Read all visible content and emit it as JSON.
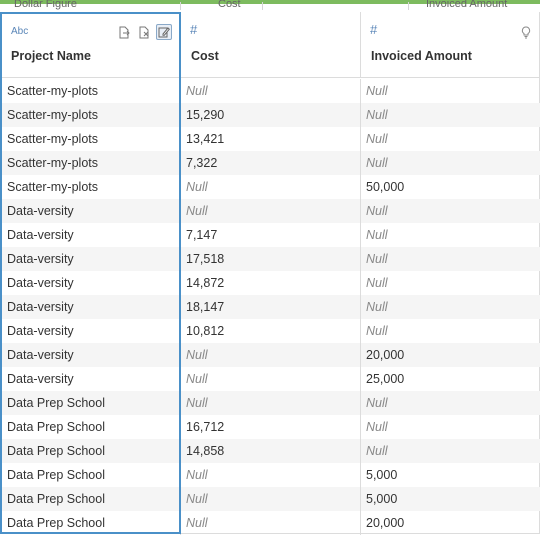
{
  "top_ghost": {
    "col1": "Dollar Figure",
    "col2": "Cost",
    "col3": "Invoiced Amount"
  },
  "columns": [
    {
      "type": "Abc",
      "name": "Project Name"
    },
    {
      "type": "#",
      "name": "Cost"
    },
    {
      "type": "#",
      "name": "Invoiced Amount"
    }
  ],
  "rows": [
    [
      "Scatter-my-plots",
      "Null",
      "Null"
    ],
    [
      "Scatter-my-plots",
      "15,290",
      "Null"
    ],
    [
      "Scatter-my-plots",
      "13,421",
      "Null"
    ],
    [
      "Scatter-my-plots",
      "7,322",
      "Null"
    ],
    [
      "Scatter-my-plots",
      "Null",
      "50,000"
    ],
    [
      "Data-versity",
      "Null",
      "Null"
    ],
    [
      "Data-versity",
      "7,147",
      "Null"
    ],
    [
      "Data-versity",
      "17,518",
      "Null"
    ],
    [
      "Data-versity",
      "14,872",
      "Null"
    ],
    [
      "Data-versity",
      "18,147",
      "Null"
    ],
    [
      "Data-versity",
      "10,812",
      "Null"
    ],
    [
      "Data-versity",
      "Null",
      "20,000"
    ],
    [
      "Data-versity",
      "Null",
      "25,000"
    ],
    [
      "Data Prep School",
      "Null",
      "Null"
    ],
    [
      "Data Prep School",
      "16,712",
      "Null"
    ],
    [
      "Data Prep School",
      "14,858",
      "Null"
    ],
    [
      "Data Prep School",
      "Null",
      "5,000"
    ],
    [
      "Data Prep School",
      "Null",
      "5,000"
    ],
    [
      "Data Prep School",
      "Null",
      "20,000"
    ]
  ],
  "icons": {
    "col1": [
      "export-icon",
      "remove-field-icon",
      "edit-icon"
    ],
    "col3": [
      "lightbulb-icon"
    ]
  },
  "colors": {
    "selection_border": "#4a90c8",
    "type_icon": "#5a86b8",
    "null_text": "#888888",
    "top_bar": "#7dbb5f"
  }
}
